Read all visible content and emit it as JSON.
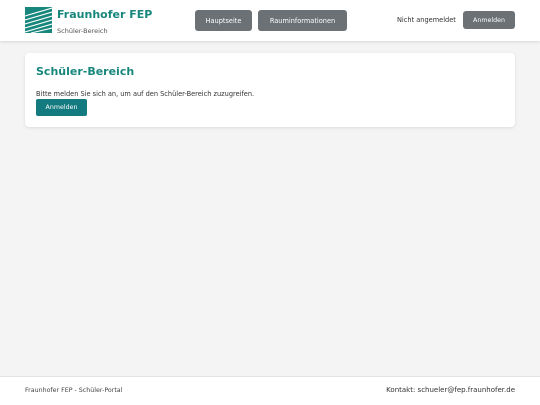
{
  "brand": {
    "title": "Fraunhofer FEP",
    "subtitle": "Schüler-Bereich",
    "logo_icon": "fraunhofer-logo",
    "accent_color": "#17877d"
  },
  "nav": {
    "home_label": "Hauptseite",
    "rooms_label": "Rauminformationen"
  },
  "header": {
    "login_status": "Nicht angemeldet",
    "login_button": "Anmelden"
  },
  "main": {
    "title": "Schüler-Bereich",
    "message": "Bitte melden Sie sich an, um auf den Schüler-Bereich zuzugreifen.",
    "login_button": "Anmelden",
    "button_color": "#137a80"
  },
  "footer": {
    "left": "Fraunhofer FEP - Schüler-Portal",
    "contact": "Kontakt: schueler@fep.fraunhofer.de"
  }
}
